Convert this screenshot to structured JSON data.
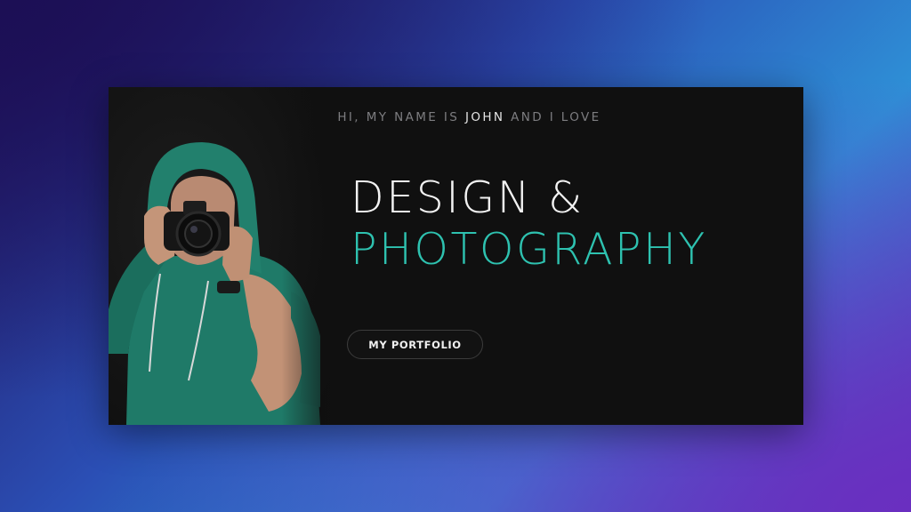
{
  "hero": {
    "tagline_prefix": "HI, MY NAME IS",
    "tagline_name": "JOHN",
    "tagline_suffix": "AND I LOVE",
    "headline_line1": "DESIGN &",
    "headline_line2": "PHOTOGRAPHY",
    "button_label": "MY PORTFOLIO"
  },
  "colors": {
    "accent": "#2ec2b0",
    "panel": "#101010",
    "text_muted": "#7d7d80"
  }
}
